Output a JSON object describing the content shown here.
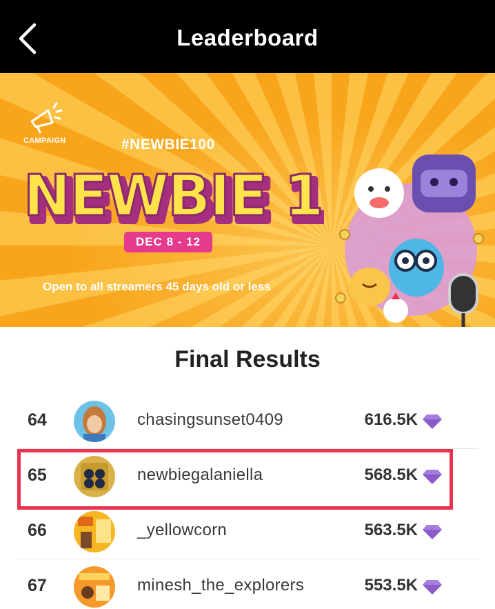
{
  "header": {
    "title": "Leaderboard"
  },
  "banner": {
    "campaign_label": "CAMPAIGN",
    "hashtag": "#NEWBIE100",
    "logo_text": "NEWBIE 100",
    "date_range": "DEC 8 - 12",
    "eligibility": "Open to all streamers 45 days old or less"
  },
  "section_title": "Final Results",
  "leaderboard": [
    {
      "rank": "64",
      "username": "chasingsunset0409",
      "score": "616.5K"
    },
    {
      "rank": "65",
      "username": "newbiegalaniella",
      "score": "568.5K",
      "highlighted": true
    },
    {
      "rank": "66",
      "username": "_yellowcorn",
      "score": "563.5K"
    },
    {
      "rank": "67",
      "username": "minesh_the_explorers",
      "score": "553.5K"
    }
  ],
  "colors": {
    "header_bg": "#000000",
    "banner_orange": "#f8a51c",
    "date_pill": "#e63b8c",
    "highlight_border": "#e8344f",
    "gem_purple": "#8b5cc9"
  },
  "icons": {
    "back": "chevron-left-icon",
    "campaign": "megaphone-icon",
    "currency": "diamond-gem-icon"
  }
}
